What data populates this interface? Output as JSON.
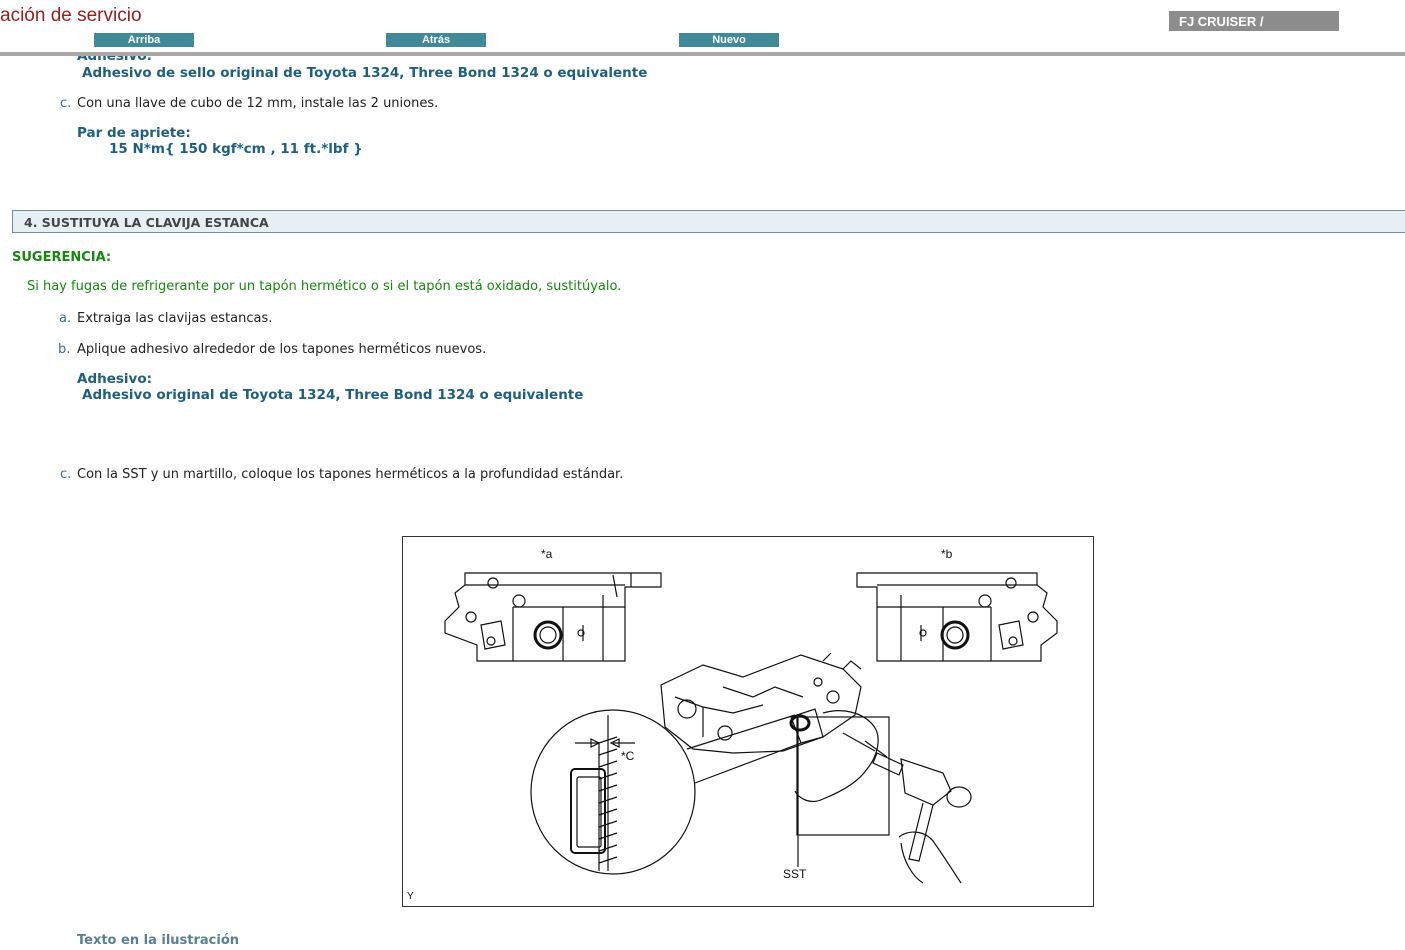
{
  "header": {
    "title": "ación de servicio",
    "nav": {
      "up": "Arriba",
      "back": "Atrás",
      "new": "Nuevo"
    },
    "vehicle": "FJ CRUISER /"
  },
  "content": {
    "cut_label": "Adhesivo:",
    "adhesive_1": "Adhesivo de sello original de Toyota 1324, Three Bond 1324 o equivalente",
    "step_c1": {
      "letter": "c.",
      "text": "Con una llave de cubo de 12 mm, instale las 2 uniones."
    },
    "torque": {
      "label": "Par de apriete:",
      "value": "15 N*m{ 150 kgf*cm , 11 ft.*lbf }"
    },
    "section": "4. SUSTITUYA LA CLAVIJA ESTANCA",
    "hint": {
      "label": "SUGERENCIA:",
      "text": "Si hay fugas de refrigerante por un tapón hermético o si el tapón está oxidado, sustitúyalo."
    },
    "step_a": {
      "letter": "a.",
      "text": "Extraiga las clavijas estancas."
    },
    "step_b": {
      "letter": "b.",
      "text": "Aplique adhesivo alrededor de los tapones herméticos nuevos."
    },
    "adhesive_label": "Adhesivo:",
    "adhesive_2": "Adhesivo original de Toyota 1324, Three Bond 1324 o equivalente",
    "step_c2": {
      "letter": "c.",
      "text": "Con la SST y un martillo, coloque los tapones herméticos a la profundidad estándar."
    },
    "figure": {
      "label_a": "*a",
      "label_b": "*b",
      "label_c": "*C",
      "label_sst": "SST",
      "label_y": "Y"
    },
    "illustration_text": "Texto en la ilustración"
  },
  "colors": {
    "title": "#9b1c1c",
    "nav_button": "#3f8a96",
    "vehicle_badge": "#8d8d8d",
    "emphasis_blue": "#1f5f7e",
    "hint_green": "#17870f",
    "section_bg": "#e6f0f4"
  }
}
